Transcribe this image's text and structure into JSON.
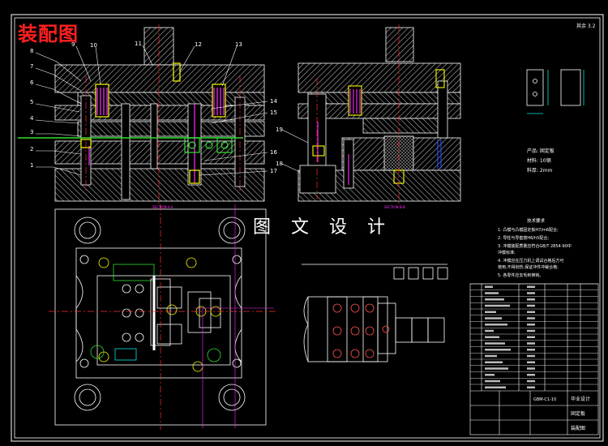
{
  "drawing": {
    "header_label": "装配图",
    "watermark": "图 文 设 计",
    "corner_note": "其余 3.2",
    "section_labels": [
      "SECTION A-A",
      "SECTION B-B"
    ],
    "part_numbers_left": [
      "8",
      "7",
      "6",
      "5",
      "4",
      "3",
      "2",
      "1"
    ],
    "part_numbers_top": [
      "9",
      "10",
      "11",
      "12",
      "13"
    ],
    "part_numbers_right": [
      "14",
      "15",
      "16",
      "17"
    ],
    "part_numbers_section_b": [
      "19",
      "18"
    ],
    "product_info": [
      "产品: 固定板",
      "材料: 10钢",
      "料厚: 2mm"
    ],
    "tech_req_title": "技术要求",
    "tech_requirements": [
      "1. 凸模与凸模固定板H7/m6配合;",
      "2. 导柱与导套按H6/h5配合;",
      "3. 冲模装配质量应符合GB/T 2854-90中",
      "   冲模标准;",
      "4. 冲模应在压力机上调试合格后方可",
      "   使用,不得划伤,保证冲件冲裁合格;",
      "5. 各零件应去毛刺倒钝。"
    ],
    "title_block": {
      "school": "毕业设计",
      "drawing_name": "固定板",
      "drawing_no": "GBM-C1-10",
      "type": "装配图"
    },
    "colors": {
      "background": "#000000",
      "outline": "#ffffff",
      "hatch": "#c8c8c8",
      "centerline": "#ff3030",
      "dimension": "#00e5e5",
      "accent_green": "#30e030",
      "accent_yellow": "#ffff00",
      "accent_magenta": "#ff30ff",
      "header": "#ff2020"
    }
  }
}
